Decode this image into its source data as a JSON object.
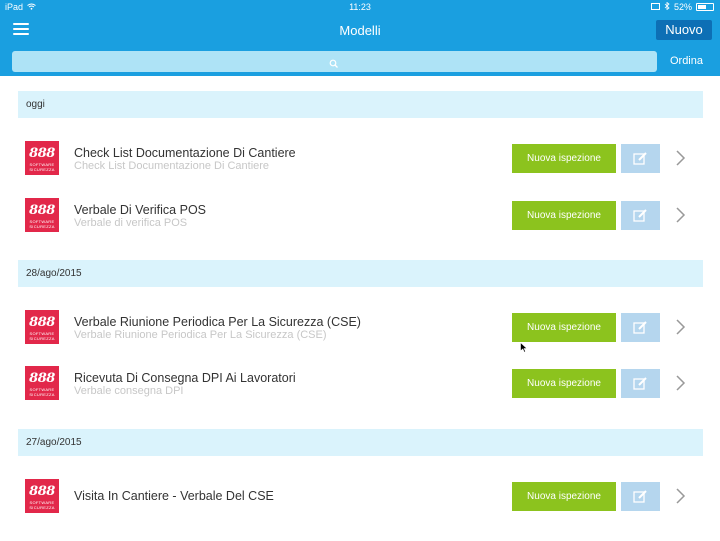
{
  "status_bar": {
    "device": "iPad",
    "time": "11:23",
    "battery": "52%"
  },
  "nav": {
    "title": "Modelli",
    "new_label": "Nuovo"
  },
  "search": {
    "placeholder": "",
    "order_label": "Ordina"
  },
  "logo": {
    "digits": "888",
    "tag": "SOFTWARE SICUREZZA"
  },
  "sections": [
    {
      "header": "oggi",
      "items": [
        {
          "title": "Check List Documentazione Di Cantiere",
          "subtitle": "Check List Documentazione Di Cantiere",
          "button": "Nuova ispezione"
        },
        {
          "title": "Verbale Di Verifica POS",
          "subtitle": "Verbale di verifica POS",
          "button": "Nuova ispezione"
        }
      ]
    },
    {
      "header": "28/ago/2015",
      "items": [
        {
          "title": "Verbale Riunione Periodica Per La Sicurezza (CSE)",
          "subtitle": "Verbale Riunione Periodica Per La Sicurezza (CSE)",
          "button": "Nuova ispezione"
        },
        {
          "title": "Ricevuta Di Consegna DPI Ai Lavoratori",
          "subtitle": "Verbale consegna DPI",
          "button": "Nuova ispezione"
        }
      ]
    },
    {
      "header": "27/ago/2015",
      "items": [
        {
          "title": "Visita In Cantiere - Verbale Del CSE",
          "subtitle": "",
          "button": "Nuova ispezione"
        }
      ]
    }
  ],
  "colors": {
    "accent": "#1a9fe0",
    "button_green": "#8cc31e",
    "edit_blue": "#b5d6ee",
    "section_bg": "#daf3fc",
    "logo_red": "#e2284a"
  }
}
